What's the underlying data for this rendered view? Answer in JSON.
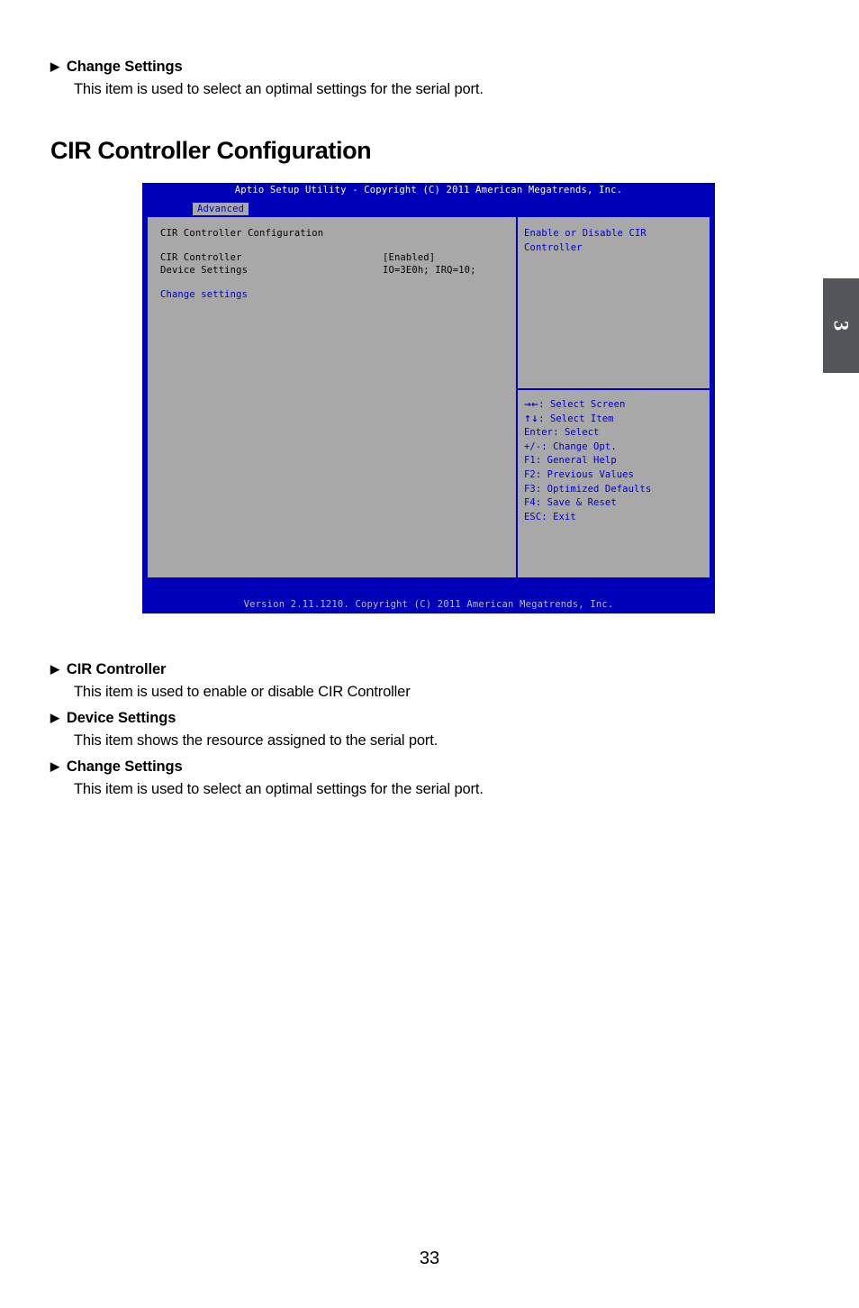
{
  "page": {
    "number": "33",
    "chapter_tab": "3"
  },
  "top_section": {
    "items": [
      {
        "marker": "▶",
        "title": "Change Settings",
        "description": "This item is used to select an optimal settings for the serial port."
      }
    ]
  },
  "section_heading": "CIR Controller Configuration",
  "bios": {
    "title": "Aptio Setup Utility - Copyright (C) 2011 American Megatrends, Inc.",
    "active_tab": "Advanced",
    "panel_heading": "CIR Controller Configuration",
    "settings": [
      {
        "label": "CIR Controller",
        "value": "[Enabled]"
      },
      {
        "label": "Device Settings",
        "value": "IO=3E0h; IRQ=10;"
      }
    ],
    "link": "Change settings",
    "help_text_line1": "Enable or Disable CIR",
    "help_text_line2": "Controller",
    "keys": [
      {
        "glyph": "→←",
        "text": ": Select Screen"
      },
      {
        "glyph": "↑↓",
        "text": ": Select Item"
      },
      {
        "glyph": "",
        "text": "Enter: Select"
      },
      {
        "glyph": "",
        "text": "+/-: Change Opt."
      },
      {
        "glyph": "",
        "text": "F1: General Help"
      },
      {
        "glyph": "",
        "text": "F2: Previous Values"
      },
      {
        "glyph": "",
        "text": "F3: Optimized Defaults"
      },
      {
        "glyph": "",
        "text": "F4: Save & Reset"
      },
      {
        "glyph": "",
        "text": "ESC: Exit"
      }
    ],
    "footer": "Version 2.11.1210. Copyright (C) 2011 American Megatrends, Inc.",
    "colors": {
      "chrome_blue": "#0000b8",
      "panel_gray": "#a8a8a8",
      "border_blue": "#0000c0",
      "link_blue": "#0000c0"
    }
  },
  "bottom_section": {
    "items": [
      {
        "marker": "▶",
        "title": "CIR Controller",
        "description": "This item is used to enable or disable CIR Controller"
      },
      {
        "marker": "▶",
        "title": "Device Settings",
        "description": "This item shows the resource assigned to the serial port."
      },
      {
        "marker": "▶",
        "title": "Change Settings",
        "description": "This item is used to select an optimal settings for the serial port."
      }
    ]
  }
}
